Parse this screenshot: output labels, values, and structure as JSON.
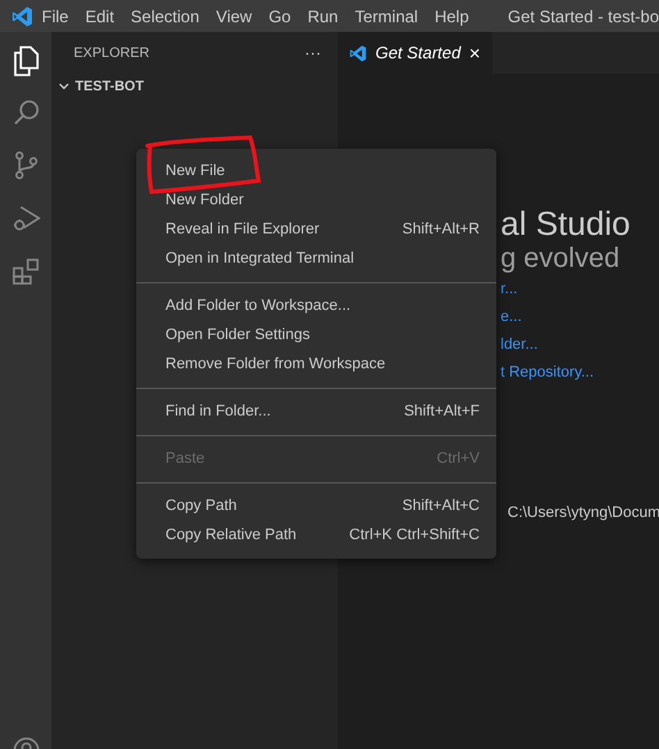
{
  "menu_bar": [
    "File",
    "Edit",
    "Selection",
    "View",
    "Go",
    "Run",
    "Terminal",
    "Help"
  ],
  "window": {
    "title": "Get Started - test-bo"
  },
  "sidebar": {
    "title": "EXPLORER",
    "actions": "···",
    "folder": {
      "label": "TEST-BOT",
      "expanded": true
    }
  },
  "tabs": [
    {
      "label": "Get Started",
      "selected": true,
      "close": "×"
    }
  ],
  "editor": {
    "heading": "al Studio",
    "subheading": "g evolved",
    "links": [
      "r...",
      "e...",
      "lder...",
      "t Repository..."
    ],
    "path": "C:\\Users\\ytyng\\Docum"
  },
  "context_menu": [
    [
      {
        "label": "New File",
        "disabled": false
      },
      {
        "label": "New Folder",
        "disabled": false
      },
      {
        "label": "Reveal in File Explorer",
        "shortcut": "Shift+Alt+R",
        "disabled": false
      },
      {
        "label": "Open in Integrated Terminal",
        "disabled": false
      }
    ],
    [
      {
        "label": "Add Folder to Workspace...",
        "disabled": false
      },
      {
        "label": "Open Folder Settings",
        "disabled": false
      },
      {
        "label": "Remove Folder from Workspace",
        "disabled": false
      }
    ],
    [
      {
        "label": "Find in Folder...",
        "shortcut": "Shift+Alt+F",
        "disabled": false
      }
    ],
    [
      {
        "label": "Paste",
        "shortcut": "Ctrl+V",
        "disabled": true
      }
    ],
    [
      {
        "label": "Copy Path",
        "shortcut": "Shift+Alt+C",
        "disabled": false
      },
      {
        "label": "Copy Relative Path",
        "shortcut": "Ctrl+K Ctrl+Shift+C",
        "disabled": false
      }
    ]
  ]
}
